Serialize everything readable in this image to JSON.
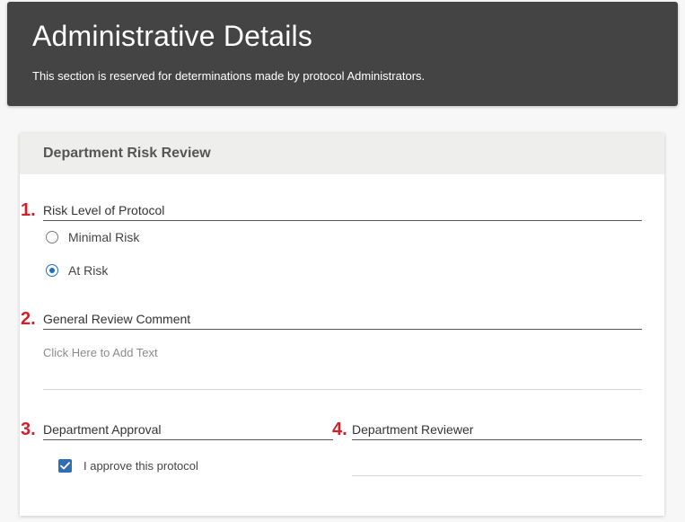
{
  "header": {
    "title": "Administrative Details",
    "subtitle": "This section is reserved for determinations made by protocol Administrators."
  },
  "card": {
    "title": "Department Risk Review"
  },
  "questions": {
    "q1": {
      "number": "1.",
      "label": "Risk Level of Protocol",
      "options": [
        {
          "label": "Minimal Risk",
          "selected": false
        },
        {
          "label": "At Risk",
          "selected": true
        }
      ]
    },
    "q2": {
      "number": "2.",
      "label": "General Review Comment",
      "placeholder": "Click Here to Add Text"
    },
    "q3": {
      "number": "3.",
      "label": "Department Approval",
      "checkbox_label": "I approve this protocol",
      "checked": true
    },
    "q4": {
      "number": "4.",
      "label": "Department Reviewer",
      "value": ""
    }
  },
  "colors": {
    "header_bg": "#444444",
    "accent": "#2f6db5",
    "number_red": "#d0202a",
    "card_head_bg": "#eeeeec"
  }
}
